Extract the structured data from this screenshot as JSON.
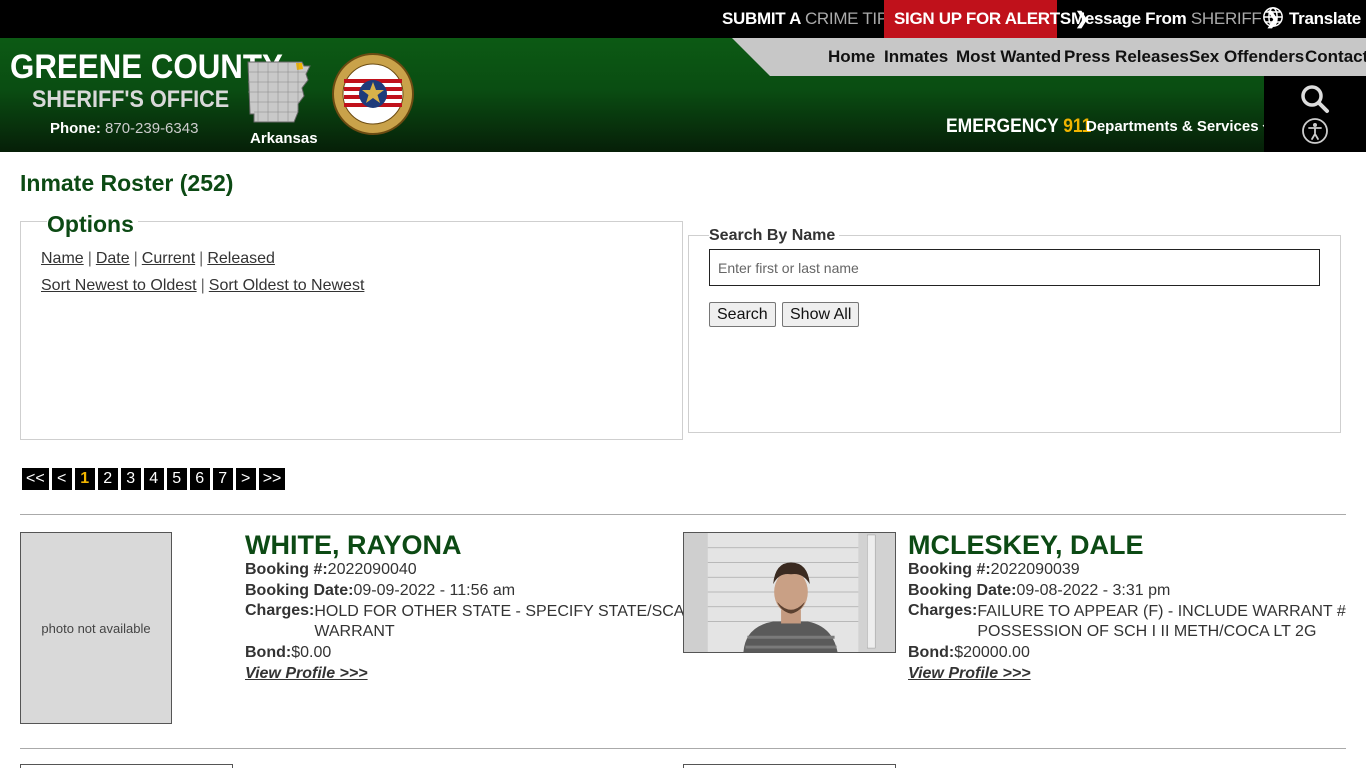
{
  "topbar": {
    "crime_tip_a": "SUBMIT A",
    "crime_tip_b": "CRIME TIP",
    "alerts": "SIGN UP FOR ALERTS",
    "sheriff_a": "Message From",
    "sheriff_b": "SHERIFF",
    "translate": "Translate"
  },
  "brand": {
    "title": "GREENE COUNTY",
    "subtitle": "SHERIFF'S OFFICE",
    "phone_label": "Phone:",
    "phone_number": "870-239-6343",
    "state": "Arkansas"
  },
  "nav": {
    "items": [
      "Home",
      "Inmates",
      "Most Wanted",
      "Press Releases",
      "Sex Offenders",
      "Contact"
    ],
    "emergency_label": "EMERGENCY",
    "emergency_number": "911",
    "departments": "Departments & Services"
  },
  "page": {
    "title": "Inmate Roster (252)"
  },
  "options": {
    "legend": "Options",
    "filters": [
      "Name",
      "Date",
      "Current",
      "Released"
    ],
    "sorts": [
      "Sort Newest to Oldest",
      "Sort Oldest to Newest"
    ]
  },
  "search": {
    "legend": "Search By Name",
    "placeholder": "Enter first or last name",
    "search_button": "Search",
    "show_all_button": "Show All"
  },
  "pager": {
    "items": [
      "<<",
      "<",
      "1",
      "2",
      "3",
      "4",
      "5",
      "6",
      "7",
      ">",
      ">>"
    ],
    "active": "1"
  },
  "inmates": [
    {
      "name": "WHITE, RAYONA",
      "booking_label": "Booking #:",
      "booking_number": "2022090040",
      "date_label": "Booking Date:",
      "booking_date": "09-09-2022 - 11:56 am",
      "charges_label": "Charges:",
      "charges": [
        "HOLD FOR OTHER STATE - SPECIFY STATE/SCAN",
        "WARRANT"
      ],
      "bond_label": "Bond:",
      "bond": "$0.00",
      "profile_link": "View Profile >>>",
      "photo_text": "photo not available"
    },
    {
      "name": "MCLESKEY, DALE",
      "booking_label": "Booking #:",
      "booking_number": "2022090039",
      "date_label": "Booking Date:",
      "booking_date": "09-08-2022 - 3:31 pm",
      "charges_label": "Charges:",
      "charges": [
        "FAILURE TO APPEAR (F) - INCLUDE WARRANT #",
        "POSSESSION OF SCH I II METH/COCA LT 2G"
      ],
      "bond_label": "Bond:",
      "bond": "$20000.00",
      "profile_link": "View Profile >>>"
    }
  ],
  "colors": {
    "brand_green": "#0c4a14",
    "alert_red": "#c0111b",
    "accent_gold": "#f0b400"
  },
  "icons": [
    "globe-icon",
    "search-icon",
    "accessibility-icon",
    "chevron-right-icon",
    "chevron-down-icon"
  ]
}
